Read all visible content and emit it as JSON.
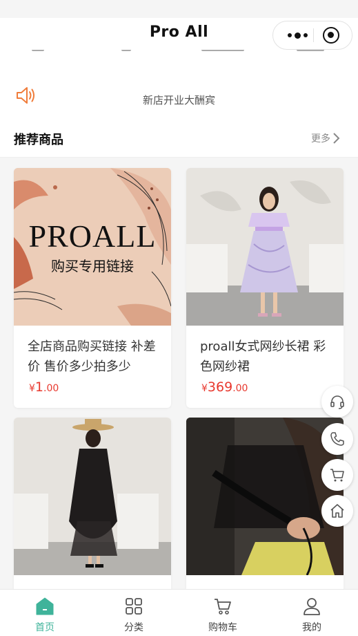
{
  "header": {
    "title": "Pro All"
  },
  "notice": {
    "text": "新店开业大酬宾",
    "icon": "speaker-icon"
  },
  "section": {
    "title": "推荐商品",
    "more_label": "更多"
  },
  "products": [
    {
      "name": "全店商品购买链接 补差价 售价多少拍多少",
      "currency": "¥",
      "price_int": "1",
      "price_dec": ".00",
      "banner_title": "PROALL",
      "banner_sub": "购买专用链接"
    },
    {
      "name": "proall女式网纱长裙 彩色网纱裙",
      "currency": "¥",
      "price_int": "369",
      "price_dec": ".00"
    },
    {
      "name": "",
      "currency": "",
      "price_int": "",
      "price_dec": ""
    },
    {
      "name": "",
      "currency": "",
      "price_int": "",
      "price_dec": ""
    }
  ],
  "floating_buttons": [
    "headset-icon",
    "phone-icon",
    "cart-icon",
    "home-icon"
  ],
  "tabbar": [
    {
      "label": "首页",
      "icon": "home-icon",
      "active": true
    },
    {
      "label": "分类",
      "icon": "grid-icon",
      "active": false
    },
    {
      "label": "购物车",
      "icon": "cart-icon",
      "active": false
    },
    {
      "label": "我的",
      "icon": "user-icon",
      "active": false
    }
  ],
  "colors": {
    "accent": "#3fb39a",
    "price": "#e8382e",
    "speaker": "#f07c3a"
  }
}
